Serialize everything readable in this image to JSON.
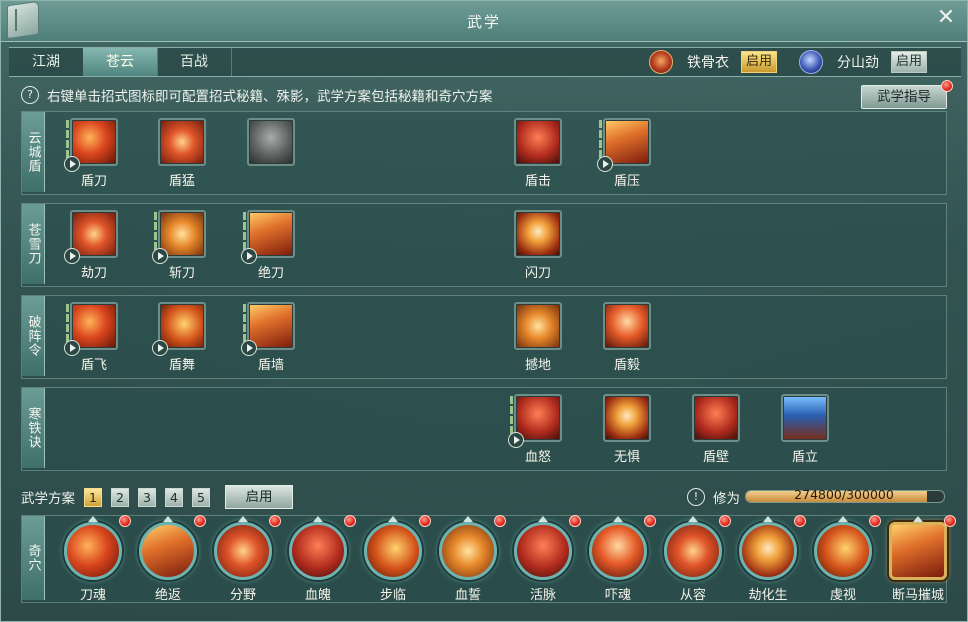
{
  "window": {
    "title": "武学",
    "close_glyph": "✕"
  },
  "tabs": [
    {
      "label": "江湖"
    },
    {
      "label": "苍云"
    },
    {
      "label": "百战"
    }
  ],
  "xinfa": [
    {
      "name": "铁骨衣",
      "apply_label": "启用",
      "icon": "shield-icon",
      "active": true
    },
    {
      "name": "分山劲",
      "apply_label": "启用",
      "icon": "blade-icon",
      "active": false
    }
  ],
  "hint": {
    "icon_glyph": "?",
    "text": "右键单击招式图标即可配置招式秘籍、殊影，武学方案包括秘籍和奇穴方案",
    "guide_label": "武学指导"
  },
  "rows": [
    {
      "label": "云城盾",
      "skills": [
        "盾刀",
        "盾猛",
        "",
        "盾击",
        "盾压"
      ]
    },
    {
      "label": "苍雪刀",
      "skills": [
        "劫刀",
        "斩刀",
        "绝刀",
        "闪刀"
      ]
    },
    {
      "label": "破阵令",
      "skills": [
        "盾飞",
        "盾舞",
        "盾墙",
        "撼地",
        "盾毅"
      ]
    },
    {
      "label": "寒铁诀",
      "skills": [
        "血怒",
        "无惧",
        "盾壁",
        "盾立"
      ]
    }
  ],
  "plan": {
    "label": "武学方案",
    "numbers": [
      "1",
      "2",
      "3",
      "4",
      "5"
    ],
    "selected": "1",
    "apply_label": "启用"
  },
  "xiuwei": {
    "icon_glyph": "!",
    "label": "修为",
    "value_text": "274800/300000",
    "current": 274800,
    "max": 300000
  },
  "qixue": {
    "label": "奇穴",
    "points": [
      "刀魂",
      "绝返",
      "分野",
      "血魄",
      "步临",
      "血誓",
      "活脉",
      "吓魂",
      "从容",
      "劫化生",
      "虔视",
      "断马摧城"
    ]
  },
  "colors": {
    "accent_gold": "#cfa23a",
    "panel_teal": "#4f7f79",
    "alert_red": "#e0261c"
  }
}
